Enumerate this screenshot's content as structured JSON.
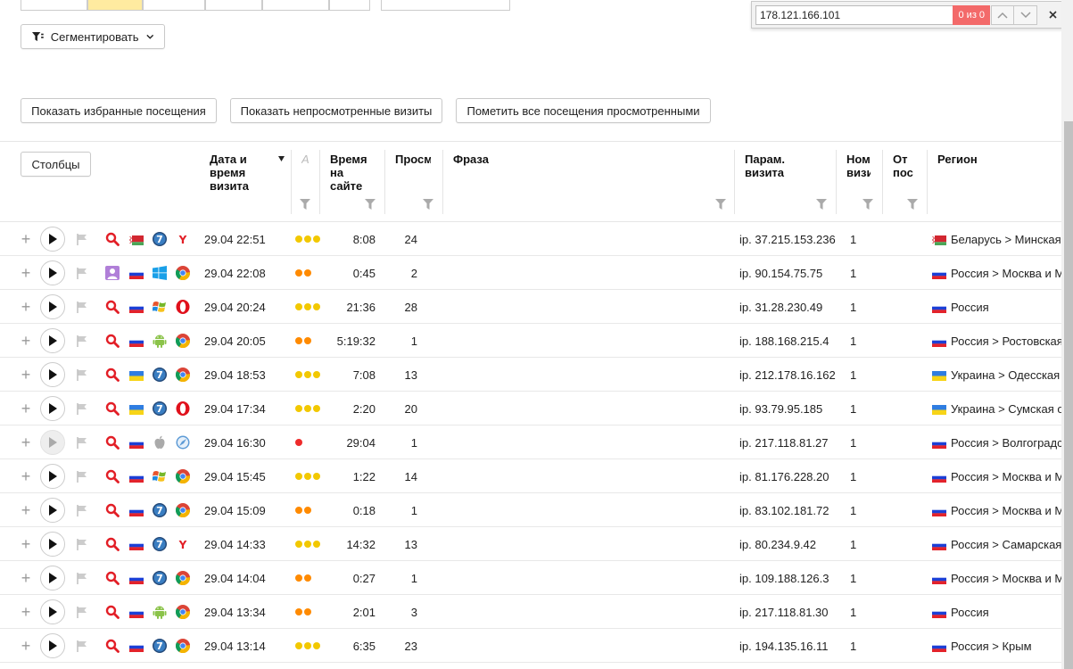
{
  "find": {
    "query": "178.121.166.101",
    "count": "0 из 0"
  },
  "toolbar": {
    "segment_label": "Сегментировать",
    "show_favorites": "Показать избранные посещения",
    "show_unviewed": "Показать непросмотренные визиты",
    "mark_all_viewed": "Пометить все посещения просмотренными",
    "columns_label": "Столбцы"
  },
  "columns": {
    "date": "Дата и время визита",
    "a": "А",
    "time": "Время на сайте",
    "views": "Просм",
    "phrase": "Фраза",
    "params": "Парам. визита",
    "num": "Ном визи",
    "from": "От пос",
    "region": "Регион"
  },
  "colors": {
    "dot_yellow": "#f2c800",
    "dot_orange": "#ff8a00",
    "dot_red": "#ee2b2b",
    "find_count_bg": "#f36a6a"
  },
  "rows": [
    {
      "source": "search",
      "flag": "by",
      "os": "win7",
      "browser": "yandex",
      "date": "29.04 22:51",
      "dots": "yyy",
      "time": "8:08",
      "views": "24",
      "ip": "ip. 37.215.153.236",
      "num": "1",
      "region_flag": "by",
      "region": "Беларусь > Минская о"
    },
    {
      "source": "avatar",
      "flag": "ru",
      "os": "win10",
      "browser": "chrome",
      "date": "29.04 22:08",
      "dots": "oo",
      "time": "0:45",
      "views": "2",
      "ip": "ip. 90.154.75.75",
      "num": "1",
      "region_flag": "ru",
      "region": "Россия > Москва и М"
    },
    {
      "source": "search",
      "flag": "ru",
      "os": "winxp",
      "browser": "opera",
      "date": "29.04 20:24",
      "dots": "yyy",
      "time": "21:36",
      "views": "28",
      "ip": "ip. 31.28.230.49",
      "num": "1",
      "region_flag": "ru",
      "region": "Россия"
    },
    {
      "source": "search",
      "flag": "ru",
      "os": "android",
      "browser": "chrome",
      "date": "29.04 20:05",
      "dots": "oo",
      "time": "5:19:32",
      "views": "1",
      "ip": "ip. 188.168.215.4",
      "num": "1",
      "region_flag": "ru",
      "region": "Россия > Ростовская"
    },
    {
      "source": "search",
      "flag": "ua",
      "os": "win7",
      "browser": "chrome",
      "date": "29.04 18:53",
      "dots": "yyy",
      "time": "7:08",
      "views": "13",
      "ip": "ip. 212.178.16.162",
      "num": "1",
      "region_flag": "ua",
      "region": "Украина > Одесская о"
    },
    {
      "source": "search",
      "flag": "ua",
      "os": "win7",
      "browser": "opera",
      "date": "29.04 17:34",
      "dots": "yyy",
      "time": "2:20",
      "views": "20",
      "ip": "ip. 93.79.95.185",
      "num": "1",
      "region_flag": "ua",
      "region": "Украина > Сумская о"
    },
    {
      "source": "search",
      "flag": "ru",
      "os": "apple",
      "browser": "safari",
      "date": "29.04 16:30",
      "dots": "r",
      "time": "29:04",
      "views": "1",
      "ip": "ip. 217.118.81.27",
      "num": "1",
      "region_flag": "ru",
      "region": "Россия > Волгоградск",
      "disabled": true
    },
    {
      "source": "search",
      "flag": "ru",
      "os": "winxp",
      "browser": "chrome",
      "date": "29.04 15:45",
      "dots": "yyy",
      "time": "1:22",
      "views": "14",
      "ip": "ip. 81.176.228.20",
      "num": "1",
      "region_flag": "ru",
      "region": "Россия > Москва и М"
    },
    {
      "source": "search",
      "flag": "ru",
      "os": "win7",
      "browser": "chrome",
      "date": "29.04 15:09",
      "dots": "oo",
      "time": "0:18",
      "views": "1",
      "ip": "ip. 83.102.181.72",
      "num": "1",
      "region_flag": "ru",
      "region": "Россия > Москва и М"
    },
    {
      "source": "search",
      "flag": "ru",
      "os": "win7",
      "browser": "yandex",
      "date": "29.04 14:33",
      "dots": "yyy",
      "time": "14:32",
      "views": "13",
      "ip": "ip. 80.234.9.42",
      "num": "1",
      "region_flag": "ru",
      "region": "Россия > Самарская"
    },
    {
      "source": "search",
      "flag": "ru",
      "os": "win7",
      "browser": "chrome",
      "date": "29.04 14:04",
      "dots": "oo",
      "time": "0:27",
      "views": "1",
      "ip": "ip. 109.188.126.3",
      "num": "1",
      "region_flag": "ru",
      "region": "Россия > Москва и М"
    },
    {
      "source": "search",
      "flag": "ru",
      "os": "android",
      "browser": "chrome",
      "date": "29.04 13:34",
      "dots": "oo",
      "time": "2:01",
      "views": "3",
      "ip": "ip. 217.118.81.30",
      "num": "1",
      "region_flag": "ru",
      "region": "Россия"
    },
    {
      "source": "search",
      "flag": "ru",
      "os": "win7",
      "browser": "chrome",
      "date": "29.04 13:14",
      "dots": "yyy",
      "time": "6:35",
      "views": "23",
      "ip": "ip. 194.135.16.11",
      "num": "1",
      "region_flag": "ru",
      "region": "Россия > Крым"
    }
  ]
}
